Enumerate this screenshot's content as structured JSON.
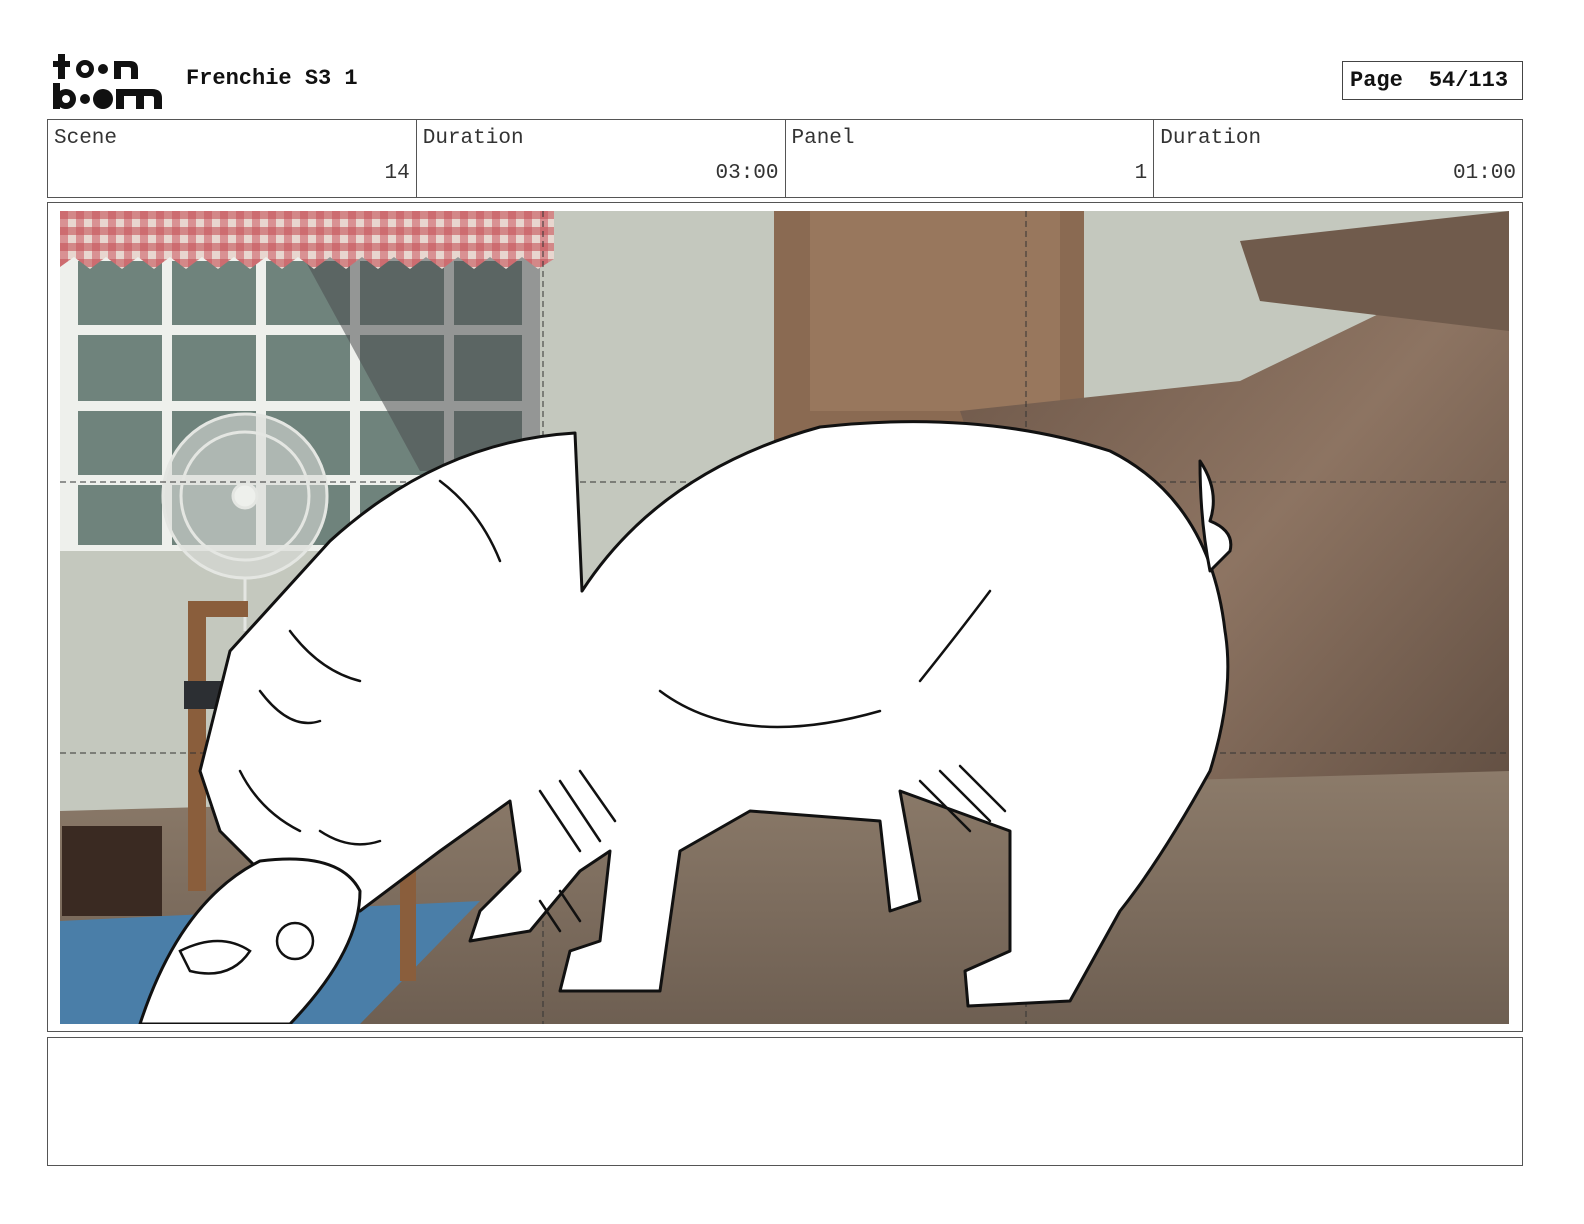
{
  "header": {
    "logo_text": "toon boom",
    "project_title": "Frenchie S3 1",
    "page_label": "Page",
    "page_value": "54/113"
  },
  "info": {
    "scene_label": "Scene",
    "scene_value": "14",
    "scene_duration_label": "Duration",
    "scene_duration_value": "03:00",
    "panel_label": "Panel",
    "panel_value": "1",
    "panel_duration_label": "Duration",
    "panel_duration_value": "01:00"
  },
  "panel": {
    "description": "",
    "colors": {
      "wall": "#c4c8be",
      "window_glass": "#6f837c",
      "curtain": "#c8585a",
      "wood": "#8a6a52",
      "sofa": "#7c6a5c",
      "floor": "#847462",
      "rug": "#4a7ea8",
      "sketch_fill": "#ffffff",
      "sketch_line": "#111111"
    }
  },
  "notes": {
    "text": ""
  }
}
